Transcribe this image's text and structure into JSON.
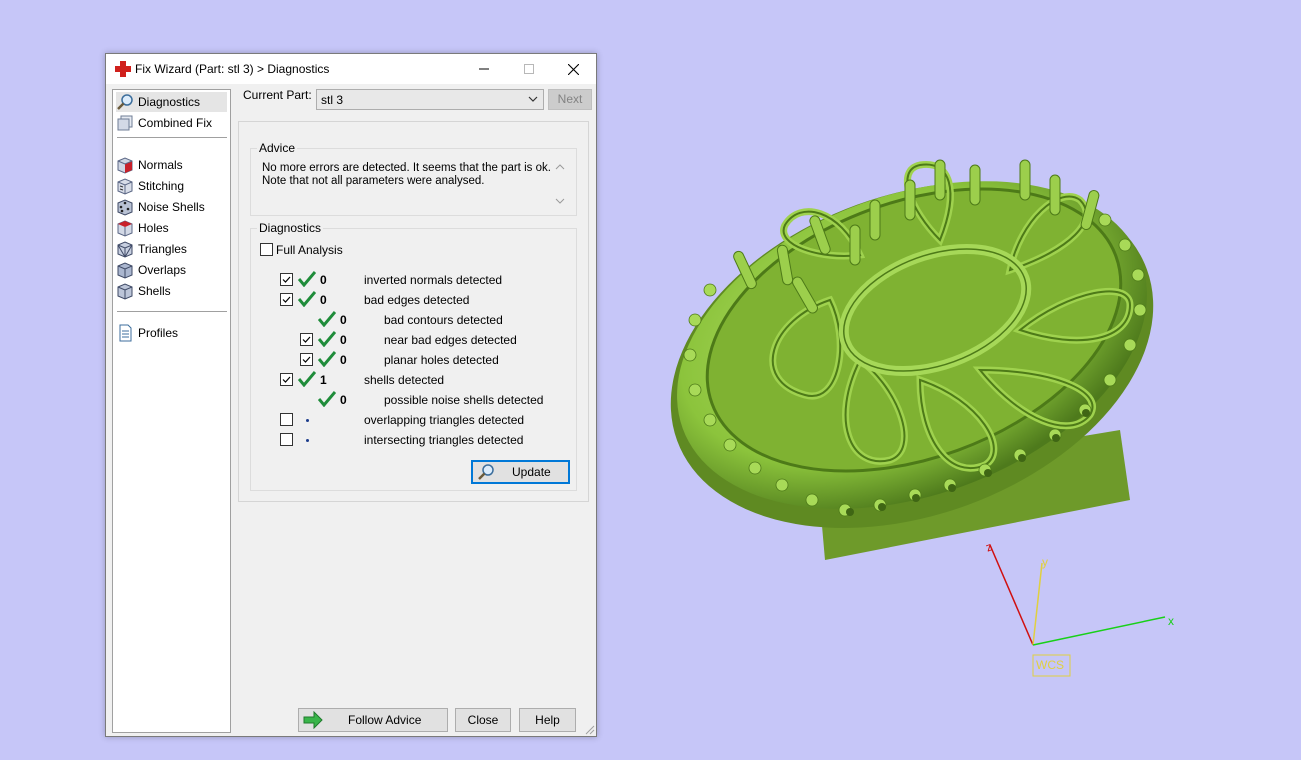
{
  "window": {
    "title": "Fix Wizard (Part: stl 3) > Diagnostics",
    "controls": {
      "minimize": "—",
      "maximize": "☐",
      "close": "✕"
    }
  },
  "sidebar": {
    "items": [
      {
        "label": "Diagnostics",
        "icon": "magnifier-icon",
        "selected": true
      },
      {
        "label": "Combined Fix",
        "icon": "combined-fix-icon"
      },
      {
        "label": "Normals",
        "icon": "normals-cube-icon"
      },
      {
        "label": "Stitching",
        "icon": "stitching-cube-icon"
      },
      {
        "label": "Noise Shells",
        "icon": "noise-shells-cube-icon"
      },
      {
        "label": "Holes",
        "icon": "holes-cube-icon"
      },
      {
        "label": "Triangles",
        "icon": "triangles-cube-icon"
      },
      {
        "label": "Overlaps",
        "icon": "overlaps-cube-icon"
      },
      {
        "label": "Shells",
        "icon": "shells-cube-icon"
      },
      {
        "label": "Profiles",
        "icon": "document-icon"
      }
    ]
  },
  "current_part": {
    "label": "Current Part:",
    "value": "stl 3",
    "next_label": "Next"
  },
  "advice": {
    "title": "Advice",
    "line1": "No more errors are detected. It seems that the part is ok.",
    "line2": "Note that not all parameters were analysed."
  },
  "diagnostics": {
    "title": "Diagnostics",
    "full_analysis_label": "Full Analysis",
    "full_analysis_checked": false,
    "rows": [
      {
        "checkbox": true,
        "checked": true,
        "status": "ok",
        "count": "0",
        "label": "inverted normals detected"
      },
      {
        "checkbox": true,
        "checked": true,
        "status": "ok",
        "count": "0",
        "label": "bad edges detected"
      },
      {
        "checkbox": false,
        "status": "ok",
        "count": "0",
        "label": "bad contours detected"
      },
      {
        "checkbox": true,
        "checked": true,
        "status": "ok",
        "count": "0",
        "label": "near bad edges detected"
      },
      {
        "checkbox": true,
        "checked": true,
        "status": "ok",
        "count": "0",
        "label": "planar holes detected"
      },
      {
        "checkbox": true,
        "checked": true,
        "status": "ok",
        "count": "1",
        "label": "shells detected"
      },
      {
        "checkbox": false,
        "status": "ok",
        "count": "0",
        "label": "possible noise shells detected"
      },
      {
        "checkbox": true,
        "checked": false,
        "status": "pending",
        "count": "",
        "label": "overlapping triangles detected"
      },
      {
        "checkbox": true,
        "checked": false,
        "status": "pending",
        "count": "",
        "label": "intersecting triangles detected"
      }
    ],
    "update_label": "Update"
  },
  "footer": {
    "follow_advice": "Follow Advice",
    "close": "Close",
    "help": "Help"
  },
  "viewport": {
    "background": "#c6c6f8",
    "model_color": "#8cc43c",
    "axes": {
      "x_label": "x",
      "y_label": "y",
      "z_label": "z",
      "wcs_label": "WCS"
    }
  }
}
